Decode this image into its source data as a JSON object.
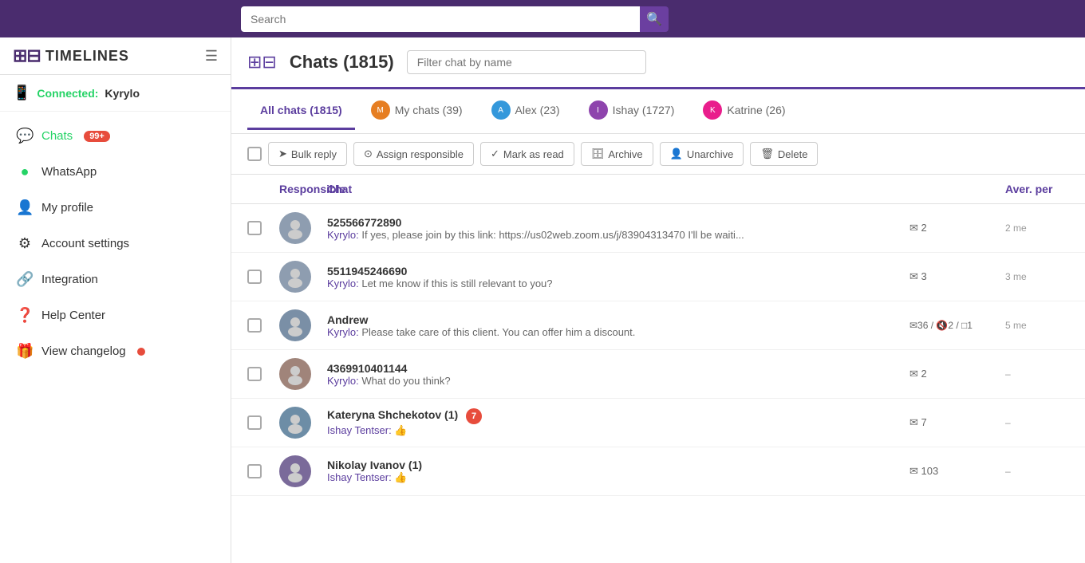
{
  "topNav": {
    "searchPlaceholder": "Search"
  },
  "logo": {
    "text": "TIMELINES",
    "hamburgerLabel": "☰"
  },
  "connectedStatus": {
    "label": "Connected:",
    "name": "Kyrylo"
  },
  "sidebar": {
    "items": [
      {
        "id": "chats",
        "label": "Chats",
        "icon": "💬",
        "badge": "99+",
        "active": true
      },
      {
        "id": "whatsapp",
        "label": "WhatsApp",
        "icon": "🟢",
        "active": false
      },
      {
        "id": "myprofile",
        "label": "My profile",
        "icon": "👤",
        "active": false
      },
      {
        "id": "accountsettings",
        "label": "Account settings",
        "icon": "⚙️",
        "active": false
      },
      {
        "id": "integration",
        "label": "Integration",
        "icon": "🔗",
        "active": false
      },
      {
        "id": "helpcenter",
        "label": "Help Center",
        "icon": "❓",
        "active": false
      },
      {
        "id": "viewchangelog",
        "label": "View changelog",
        "icon": "🎁",
        "hasDot": true,
        "active": false
      }
    ]
  },
  "contentHeader": {
    "title": "Chats (1815)",
    "filterPlaceholder": "Filter chat by name"
  },
  "tabs": [
    {
      "id": "allchats",
      "label": "All chats (1815)",
      "active": true,
      "hasAvatar": false
    },
    {
      "id": "mychats",
      "label": "My chats (39)",
      "active": false,
      "hasAvatar": true,
      "avatarBg": "#e67e22"
    },
    {
      "id": "alex",
      "label": "Alex (23)",
      "active": false,
      "hasAvatar": true,
      "avatarBg": "#3498db"
    },
    {
      "id": "ishay",
      "label": "Ishay (1727)",
      "active": false,
      "hasAvatar": true,
      "avatarBg": "#8e44ad"
    },
    {
      "id": "katrine",
      "label": "Katrine (26)",
      "active": false,
      "hasAvatar": true,
      "avatarBg": "#e91e8c"
    }
  ],
  "toolbar": {
    "bulkReply": "Bulk reply",
    "assignResponsible": "Assign responsible",
    "markAsRead": "Mark as read",
    "archive": "Archive",
    "unarchive": "Unarchive",
    "delete": "Delete"
  },
  "tableHeaders": {
    "responsible": "Responsible",
    "chat": "Chat",
    "avgPerformance": "Aver. per"
  },
  "chats": [
    {
      "id": 1,
      "name": "525566772890",
      "preview": "Kyrylo: If yes, please join by this link: https://us02web.zoom.us/j/83904313470 I'll be waiti...",
      "msgCount": "2",
      "time": "2 me",
      "unread": false,
      "bold": false
    },
    {
      "id": 2,
      "name": "5511945246690",
      "preview": "Kyrylo: Let me know if this is still relevant to you?",
      "msgCount": "3",
      "time": "3 me",
      "unread": false,
      "bold": false
    },
    {
      "id": 3,
      "name": "Andrew",
      "preview": "Kyrylo: Please take care of this client. You can offer him a discount.",
      "msgCount": "36 / 🔇2 / □1",
      "time": "5 me",
      "unread": false,
      "bold": false
    },
    {
      "id": 4,
      "name": "4369910401144",
      "preview": "Kyrylo: What do you think?",
      "msgCount": "2",
      "time": "–",
      "unread": false,
      "bold": false
    },
    {
      "id": 5,
      "name": "Kateryna Shchekotov (1)",
      "unreadBadge": "7",
      "preview": "Ishay Tentser: 👍",
      "msgCount": "7",
      "time": "–",
      "unread": true,
      "bold": true
    },
    {
      "id": 6,
      "name": "Nikolay Ivanov (1)",
      "preview": "Ishay Tentser: 👍",
      "msgCount": "103",
      "time": "–",
      "unread": false,
      "bold": false
    }
  ]
}
